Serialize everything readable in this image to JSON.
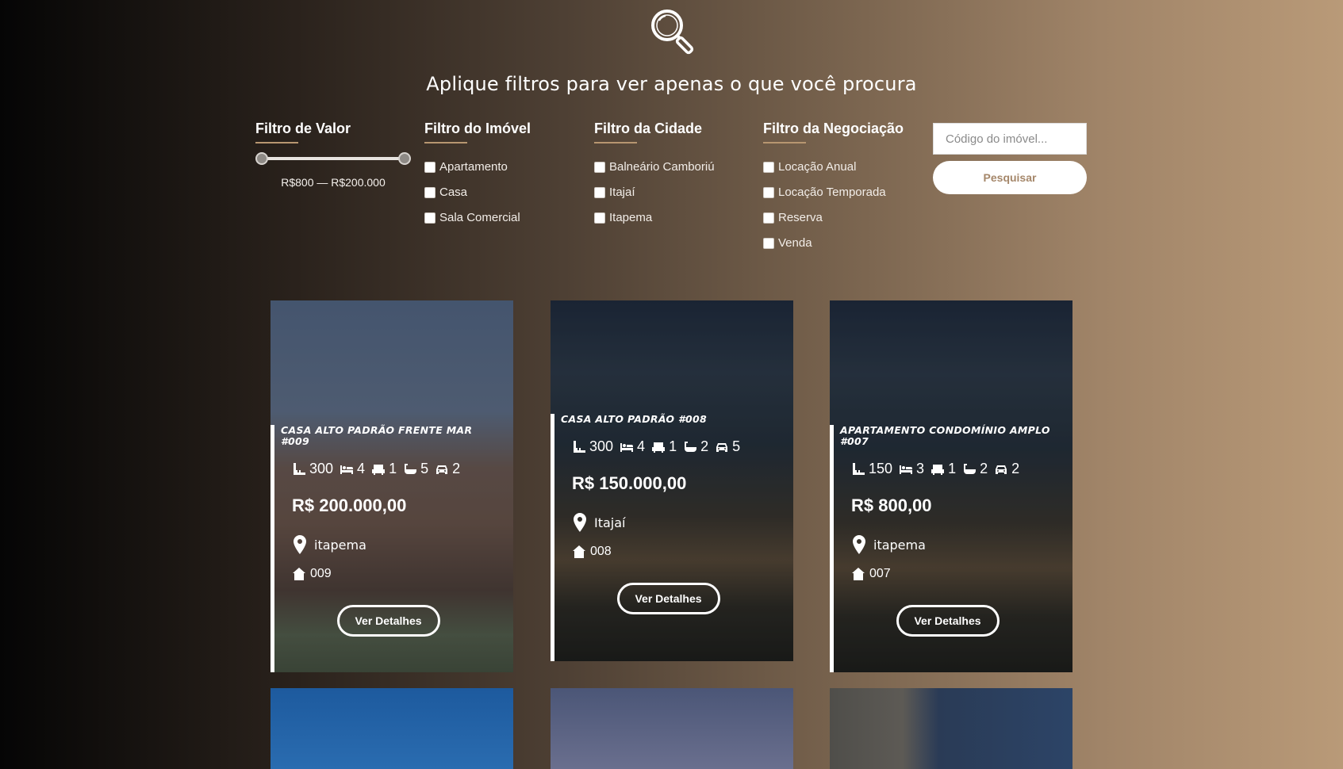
{
  "header": {
    "icon": "search-icon",
    "headline": "Aplique filtros para ver apenas o que você procura"
  },
  "filters": {
    "value": {
      "title": "Filtro de Valor",
      "range_text": "R$800 — R$200.000",
      "min": 800,
      "max": 200000
    },
    "property": {
      "title": "Filtro do Imóvel",
      "options": [
        "Apartamento",
        "Casa",
        "Sala Comercial"
      ]
    },
    "city": {
      "title": "Filtro da Cidade",
      "options": [
        "Balneário Camboriú",
        "Itajaí",
        "Itapema"
      ]
    },
    "negotiation": {
      "title": "Filtro da Negociação",
      "options": [
        "Locação Anual",
        "Locação Temporada",
        "Reserva",
        "Venda"
      ]
    },
    "code_placeholder": "Código do imóvel...",
    "search_label": "Pesquisar"
  },
  "cards": [
    {
      "title": "CASA ALTO PADRÃO FRENTE MAR #009",
      "area": "300",
      "suites": "4",
      "rooms": "1",
      "baths": "5",
      "garages": "2",
      "price": "R$ 200.000,00",
      "location": "itapema",
      "code": "009",
      "button": "Ver Detalhes"
    },
    {
      "title": "CASA ALTO PADRÃO #008",
      "area": "300",
      "suites": "4",
      "rooms": "1",
      "baths": "2",
      "garages": "5",
      "price": "R$ 150.000,00",
      "location": "Itajaí",
      "code": "008",
      "button": "Ver Detalhes"
    },
    {
      "title": "APARTAMENTO CONDOMÍNIO AMPLO #007",
      "area": "150",
      "suites": "3",
      "rooms": "1",
      "baths": "2",
      "garages": "2",
      "price": "R$ 800,00",
      "location": "itapema",
      "code": "007",
      "button": "Ver Detalhes"
    }
  ],
  "colors": {
    "accent": "#b79670",
    "button_text": "#a5876a"
  }
}
